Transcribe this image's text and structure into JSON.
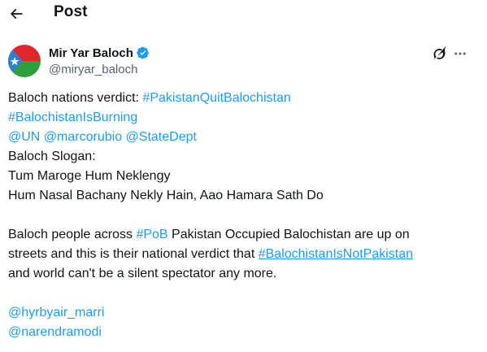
{
  "header": {
    "title": "Post"
  },
  "author": {
    "name": "Mir Yar Baloch",
    "handle": "@miryar_baloch"
  },
  "tweet": {
    "line1_text": "Baloch nations verdict: ",
    "hashtag_pakistan_quit_balochistan": "#PakistanQuitBalochistan",
    "hashtag_balochistan_is_burning": "#BalochistanIsBurning",
    "mention_un": "@UN",
    "mention_marcorubio": "@marcorubio",
    "mention_statedept": "@StateDept",
    "slogan_heading": "Baloch Slogan:",
    "slogan_line1": "Tum Maroge Hum Neklengy",
    "slogan_line2": "Hum Nasal Bachany Nekly Hain, Aao Hamara Sath Do",
    "para2_start": "Baloch people across ",
    "hashtag_pob": "#PoB",
    "para2_middle": " Pakistan Occupied Balochistan are up on",
    "para2_line2": "streets and this is their national verdict that ",
    "hashtag_balochistan_is_not_pakistan": "#BalochistanIsNotPakistan",
    "para2_line3": "and world can't be a silent spectator any more.",
    "mention_hyrbyair_marri": "@hyrbyair_marri",
    "mention_narendramodi": "@narendramodi"
  },
  "colors": {
    "link": "#1d9bf0",
    "text": "#0f1419",
    "secondary": "#536471",
    "verified": "#1d9bf0"
  },
  "icons": {
    "back": "arrow-left-icon",
    "verified": "verified-badge-icon",
    "grok": "grok-icon",
    "more": "more-horizontal-icon"
  }
}
